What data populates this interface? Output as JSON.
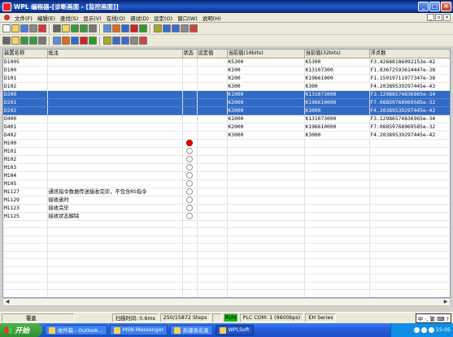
{
  "window": {
    "title": "WPL 编程器-[诊断画面 - [监控画面]]"
  },
  "menu": [
    "文件(F)",
    "编辑(E)",
    "查找(S)",
    "显示(V)",
    "在线(O)",
    "调试(D)",
    "设定(O)",
    "窗口(W)",
    "说明(H)"
  ],
  "toolbar1_icons": [
    "new-icon",
    "open-icon",
    "save-icon",
    "print-icon",
    "cut-icon",
    "copy-icon",
    "paste-icon",
    "undo-icon",
    "redo-icon",
    "find-icon",
    "zoom-icon",
    "monitor-icon",
    "ladder-icon",
    "instruction-icon",
    "device-icon",
    "stop-icon",
    "run-icon",
    "upload-icon",
    "download-icon",
    "online-icon"
  ],
  "toolbar2_icons": [
    "contact-no-icon",
    "contact-nc-icon",
    "coil-icon",
    "function-icon",
    "line-icon",
    "vline-icon",
    "delete-line-icon",
    "rising-icon",
    "falling-icon",
    "not-icon",
    "compare-icon",
    "set-icon",
    "reset-icon",
    "timer-icon",
    "counter-icon"
  ],
  "table": {
    "headers": [
      "装置名称",
      "批注",
      "状态",
      "设定值",
      "当前值(16bits)",
      "当前值(32bits)",
      "浮点数"
    ],
    "rows": [
      {
        "name": "D1005",
        "comment": "",
        "status": "",
        "setv": "",
        "v16": "K5300",
        "v32": "K5300",
        "float": "F3.42688186092153e-42",
        "sel": false,
        "dot": ""
      },
      {
        "name": "D100",
        "comment": "",
        "status": "",
        "setv": "",
        "v16": "K100",
        "v32": "K13107300",
        "float": "F1.83672593614447e-38",
        "sel": false,
        "dot": ""
      },
      {
        "name": "D101",
        "comment": "",
        "status": "",
        "setv": "",
        "v16": "K200",
        "v32": "K19661000",
        "float": "F1.15919711977347e-38",
        "sel": false,
        "dot": ""
      },
      {
        "name": "D102",
        "comment": "",
        "status": "",
        "setv": "",
        "v16": "K300",
        "v32": "K300",
        "float": "F4.20389539297445e-43",
        "sel": false,
        "dot": ""
      },
      {
        "name": "D200",
        "comment": "",
        "status": "",
        "setv": "",
        "v16": "K1000",
        "v32": "K131073000",
        "float": "F3.12986574836965e-34",
        "sel": true,
        "dot": ""
      },
      {
        "name": "D201",
        "comment": "",
        "status": "",
        "setv": "",
        "v16": "K2000",
        "v32": "K196610000",
        "float": "F7.08859768969585e-32",
        "sel": true,
        "dot": ""
      },
      {
        "name": "D202",
        "comment": "",
        "status": "",
        "setv": "",
        "v16": "K3000",
        "v32": "K3000",
        "float": "F4.20389539297445e-42",
        "sel": true,
        "dot": ""
      },
      {
        "name": "D400",
        "comment": "",
        "status": "",
        "setv": "",
        "v16": "K1000",
        "v32": "K131073000",
        "float": "F3.12986574836965e-34",
        "sel": false,
        "dot": ""
      },
      {
        "name": "D401",
        "comment": "",
        "status": "",
        "setv": "",
        "v16": "K2000",
        "v32": "K196610000",
        "float": "F7.08859768969585e-32",
        "sel": false,
        "dot": ""
      },
      {
        "name": "D402",
        "comment": "",
        "status": "",
        "setv": "",
        "v16": "K3000",
        "v32": "K3000",
        "float": "F4.20389539297445e-42",
        "sel": false,
        "dot": ""
      },
      {
        "name": "M100",
        "comment": "",
        "status": "",
        "setv": "",
        "v16": "",
        "v32": "",
        "float": "",
        "sel": false,
        "dot": "on"
      },
      {
        "name": "M101",
        "comment": "",
        "status": "",
        "setv": "",
        "v16": "",
        "v32": "",
        "float": "",
        "sel": false,
        "dot": "off"
      },
      {
        "name": "M102",
        "comment": "",
        "status": "",
        "setv": "",
        "v16": "",
        "v32": "",
        "float": "",
        "sel": false,
        "dot": "off"
      },
      {
        "name": "M103",
        "comment": "",
        "status": "",
        "setv": "",
        "v16": "",
        "v32": "",
        "float": "",
        "sel": false,
        "dot": "off"
      },
      {
        "name": "M104",
        "comment": "",
        "status": "",
        "setv": "",
        "v16": "",
        "v32": "",
        "float": "",
        "sel": false,
        "dot": "off"
      },
      {
        "name": "M105",
        "comment": "",
        "status": "",
        "setv": "",
        "v16": "",
        "v32": "",
        "float": "",
        "sel": false,
        "dot": "off"
      },
      {
        "name": "M1127",
        "comment": "通讯指令数据传送接收完毕，不包含RS指令",
        "status": "",
        "setv": "",
        "v16": "",
        "v32": "",
        "float": "",
        "sel": false,
        "dot": "off"
      },
      {
        "name": "M1129",
        "comment": "接收逾时",
        "status": "",
        "setv": "",
        "v16": "",
        "v32": "",
        "float": "",
        "sel": false,
        "dot": "off"
      },
      {
        "name": "M1123",
        "comment": "接收完毕",
        "status": "",
        "setv": "",
        "v16": "",
        "v32": "",
        "float": "",
        "sel": false,
        "dot": "off"
      },
      {
        "name": "M1125",
        "comment": "接收状态解除",
        "status": "",
        "setv": "",
        "v16": "",
        "v32": "",
        "float": "",
        "sel": false,
        "dot": "off"
      }
    ],
    "empty_rows": 16
  },
  "status": {
    "mode": "覆蓋",
    "scan_time": "扫描时间: 0.6ms",
    "steps": "250/15872 Steps",
    "run": "RUN",
    "plc_com": "PLC COM: 1  (9600bps)",
    "series": "EH Series",
    "ime": "中 ·, 繁 ⌨ ?"
  },
  "taskbar": {
    "start": "开始",
    "tasks": [
      "收件箱 - Outlook...",
      "MSN Messenger",
      "新建各名录",
      "WPLSoft"
    ],
    "clock": "15:05"
  },
  "colors": {
    "selection": "#316ac5",
    "run": "#18b518",
    "titlebar": "#0a246a"
  }
}
